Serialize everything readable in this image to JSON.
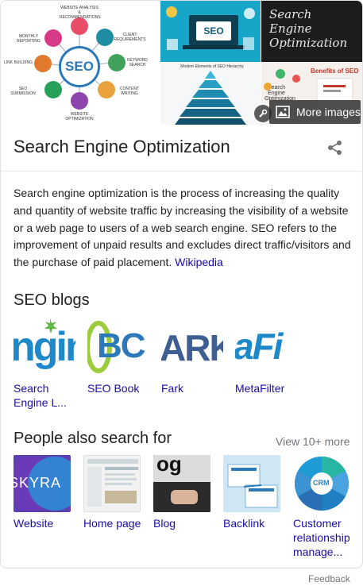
{
  "collage": {
    "t1": {
      "hub": "SEO",
      "captions": [
        "WEBSITE ANALYSIS & RECOMMENDATIONS",
        "CLIENT REQUIREMENTS",
        "KEYWORD SEARCH",
        "CONTENT WRITING",
        "WEBSITE OPTIMIZATION",
        "SEO SUBMISSION",
        "LINK BUILDING",
        "MONTHLY REPORTING"
      ]
    },
    "t2": {
      "badge": "SEO"
    },
    "t3": {
      "lines": [
        "Search",
        "Engine",
        "Optimization"
      ]
    },
    "t4": {
      "title": "Modern Elements of SEO Hierarchy"
    },
    "t5": {
      "title": "Benefits of SEO",
      "center": "Search Engine Optimization"
    },
    "more_images_label": "More images"
  },
  "entity": {
    "title": "Search Engine Optimization",
    "description": "Search engine optimization is the process of increasing the quality and quantity of website traffic by increasing the visibility of a website or a web page to users of a web search engine. SEO refers to the improvement of unpaid results and excludes direct traffic/visitors and the purchase of paid placement.",
    "source_link": "Wikipedia"
  },
  "seo_blogs": {
    "heading": "SEO blogs",
    "items": [
      {
        "label": "Search Engine L...",
        "logo": "ngin"
      },
      {
        "label": "SEO Book",
        "logo": "BC"
      },
      {
        "label": "Fark",
        "logo": "ARK"
      },
      {
        "label": "MetaFilter",
        "logo": "aFi"
      }
    ]
  },
  "people_also_search": {
    "heading": "People also search for",
    "view_more": "View 10+ more",
    "items": [
      {
        "label": "Website",
        "thumb": "SKYRA"
      },
      {
        "label": "Home page"
      },
      {
        "label": "Blog",
        "thumb": "og"
      },
      {
        "label": "Backlink"
      },
      {
        "label": "Customer relationship manage...",
        "thumb": "CRM"
      }
    ]
  },
  "feedback": "Feedback",
  "colors": {
    "link": "#1a0dab",
    "muted": "#70757a",
    "seo_blue": "#2b79b8",
    "fark_blue": "#3f5f93",
    "metafilter_green": "#9ccb3b",
    "sel_green": "#64b446"
  }
}
